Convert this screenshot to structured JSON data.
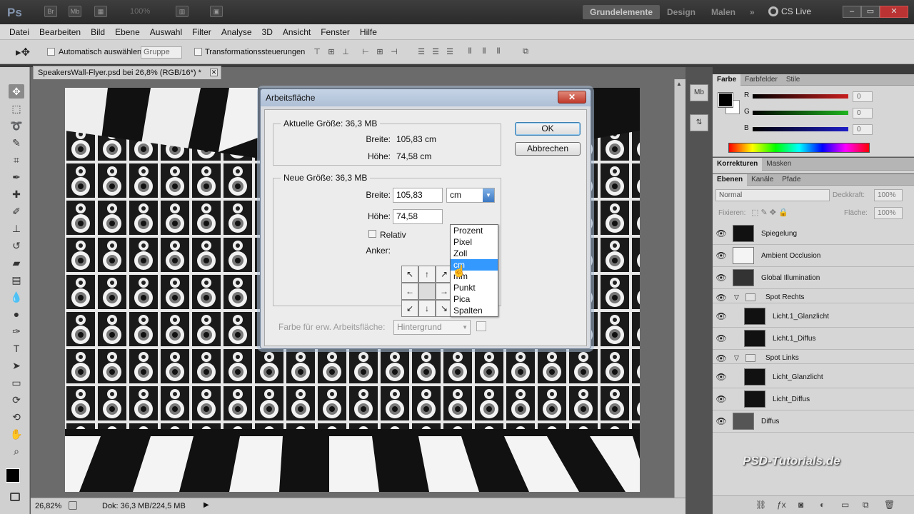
{
  "titlebar": {
    "zoom_level": "100%",
    "workspaces": [
      "Grundelemente",
      "Design",
      "Malen"
    ],
    "more": "»",
    "cs_live": "CS Live"
  },
  "menu": [
    "Datei",
    "Bearbeiten",
    "Bild",
    "Ebene",
    "Auswahl",
    "Filter",
    "Analyse",
    "3D",
    "Ansicht",
    "Fenster",
    "Hilfe"
  ],
  "options": {
    "auto_select_label": "Automatisch auswählen:",
    "auto_select_value": "Gruppe",
    "transform_label": "Transformationssteuerungen"
  },
  "document": {
    "tab_title": "SpeakersWall-Flyer.psd bei 26,8% (RGB/16*) *",
    "zoom": "26,82%",
    "doc_info": "Dok: 36,3 MB/224,5 MB"
  },
  "dialog": {
    "title": "Arbeitsfläche",
    "close": "✕",
    "current_size_label": "Aktuelle Größe: 36,3 MB",
    "current_width_label": "Breite:",
    "current_width_value": "105,83 cm",
    "current_height_label": "Höhe:",
    "current_height_value": "74,58 cm",
    "new_size_label": "Neue Größe: 36,3 MB",
    "width_label": "Breite:",
    "width_value": "105,83",
    "height_label": "Höhe:",
    "height_value": "74,58",
    "unit_value": "cm",
    "relative_label": "Relativ",
    "anchor_label": "Anker:",
    "bg_color_label": "Farbe für erw. Arbeitsfläche:",
    "bg_color_value": "Hintergrund",
    "ok": "OK",
    "cancel": "Abbrechen",
    "unit_options": [
      "Prozent",
      "Pixel",
      "Zoll",
      "cm",
      "mm",
      "Punkt",
      "Pica",
      "Spalten"
    ],
    "unit_selected_index": 3
  },
  "color_panel": {
    "tabs": [
      "Farbe",
      "Farbfelder",
      "Stile"
    ],
    "channels": [
      {
        "label": "R",
        "value": "0",
        "color": "#c81e1e"
      },
      {
        "label": "G",
        "value": "0",
        "color": "#1eb41e"
      },
      {
        "label": "B",
        "value": "0",
        "color": "#1e1ec8"
      }
    ]
  },
  "adjust_panel": {
    "tabs": [
      "Korrekturen",
      "Masken"
    ]
  },
  "layers_panel": {
    "tabs": [
      "Ebenen",
      "Kanäle",
      "Pfade"
    ],
    "blend_mode": "Normal",
    "opacity_label": "Deckkraft:",
    "opacity_value": "100%",
    "lock_label": "Fixieren:",
    "fill_label": "Fläche:",
    "fill_value": "100%",
    "layers": [
      {
        "name": "Spiegelung",
        "type": "layer"
      },
      {
        "name": "Ambient Occlusion",
        "type": "layer"
      },
      {
        "name": "Global Illumination",
        "type": "layer"
      },
      {
        "name": "Spot Rechts",
        "type": "group"
      },
      {
        "name": "Licht.1_Glanzlicht",
        "type": "sublayer"
      },
      {
        "name": "Licht.1_Diffus",
        "type": "sublayer"
      },
      {
        "name": "Spot Links",
        "type": "group"
      },
      {
        "name": "Licht_Glanzlicht",
        "type": "sublayer"
      },
      {
        "name": "Licht_Diffus",
        "type": "sublayer"
      },
      {
        "name": "Diffus",
        "type": "layer"
      }
    ]
  },
  "watermark": "PSD-Tutorials.de"
}
